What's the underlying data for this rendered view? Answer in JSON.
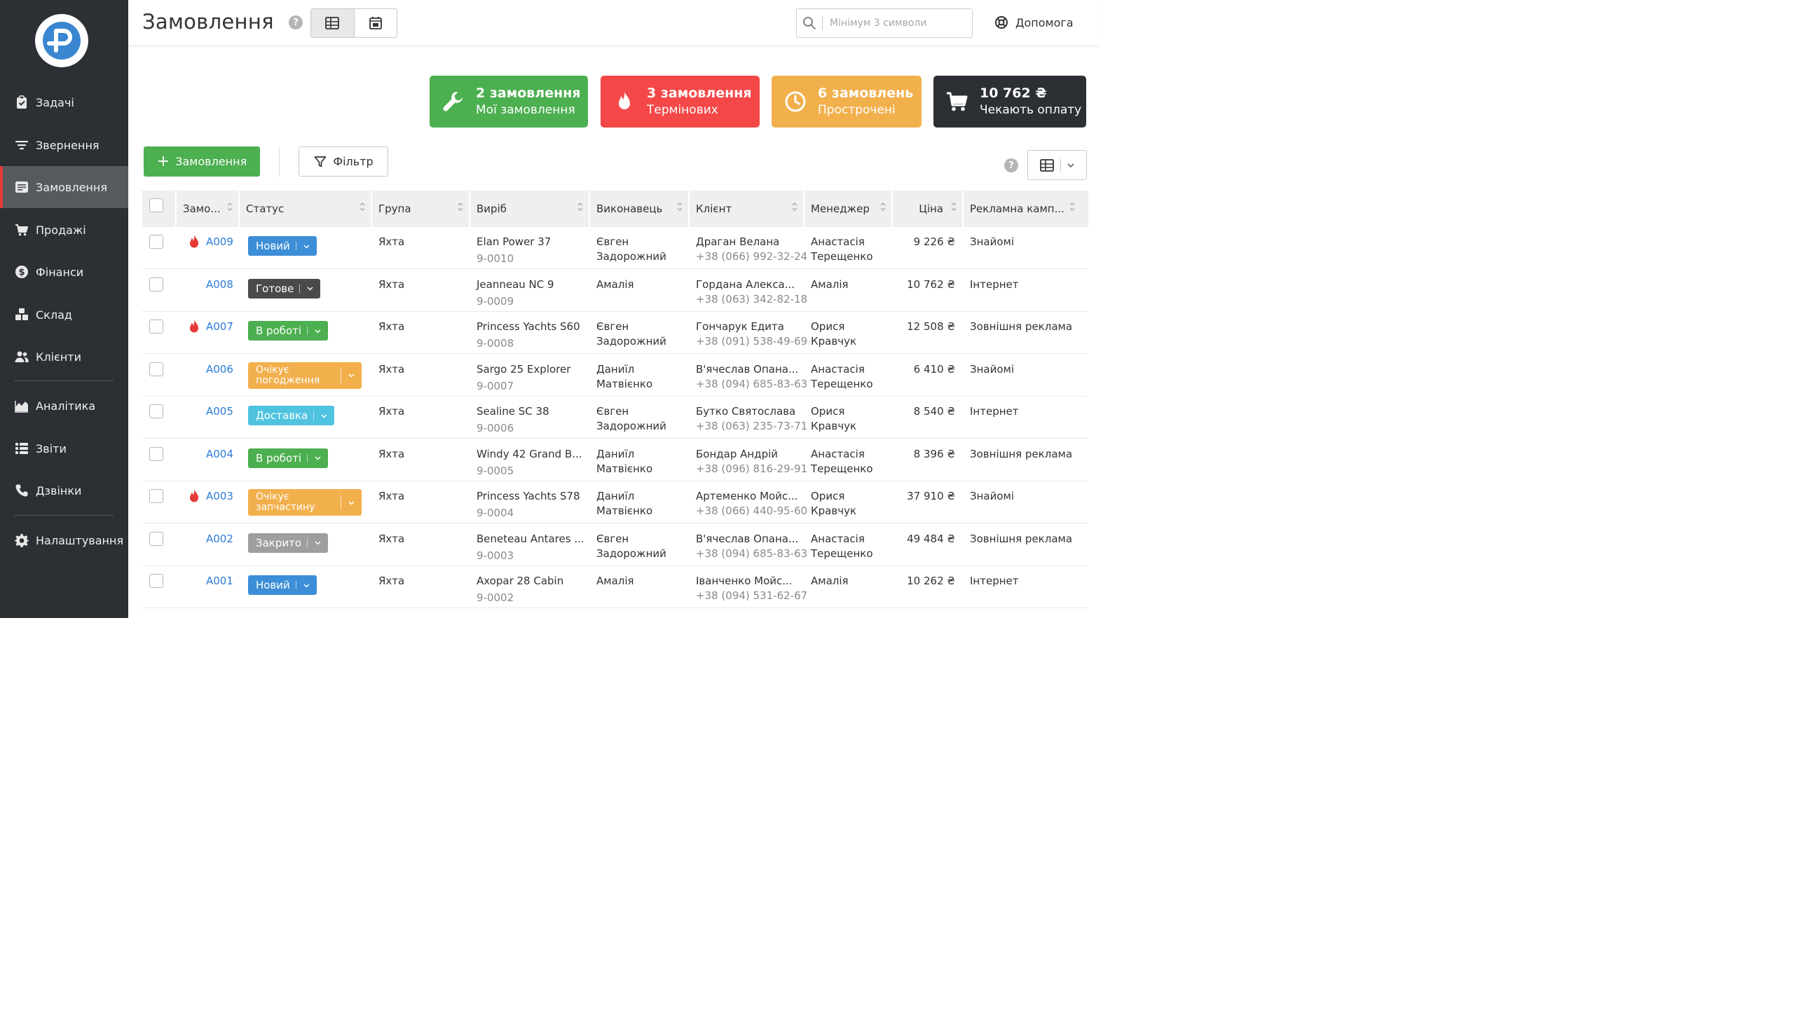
{
  "app": {
    "page_title": "Замовлення",
    "search_placeholder": "Мінімум 3 символи",
    "help_label": "Допомога",
    "help_mark": "?"
  },
  "nav": {
    "items": [
      {
        "label": "Задачі",
        "icon": "clipboard-check-icon"
      },
      {
        "label": "Звернення",
        "icon": "filter-lines-icon"
      },
      {
        "label": "Замовлення",
        "icon": "order-list-icon",
        "active": true
      },
      {
        "label": "Продажі",
        "icon": "cart-icon"
      },
      {
        "label": "Фінанси",
        "icon": "dollar-coin-icon"
      },
      {
        "label": "Склад",
        "icon": "boxes-icon"
      },
      {
        "label": "Клієнти",
        "icon": "users-icon"
      },
      {
        "label": "Аналітика",
        "icon": "area-chart-icon"
      },
      {
        "label": "Звіти",
        "icon": "report-list-icon"
      },
      {
        "label": "Дзвінки",
        "icon": "phone-icon"
      },
      {
        "label": "Налаштування",
        "icon": "gear-icon"
      }
    ]
  },
  "cards": [
    {
      "title": "2 замовлення",
      "subtitle": "Мої замовлення",
      "color": "#4caf50",
      "icon": "wrench-icon"
    },
    {
      "title": "3 замовлення",
      "subtitle": "Термінових",
      "color": "#f44848",
      "icon": "fire-icon"
    },
    {
      "title": "6 замовлень",
      "subtitle": "Прострочені",
      "color": "#f2b04d",
      "icon": "clock-icon"
    },
    {
      "title": "10 762 ₴",
      "subtitle": "Чекають оплату",
      "color": "#2c3034",
      "icon": "cart-icon"
    }
  ],
  "toolbar": {
    "add_plus": "+",
    "add_label": "Замовлення",
    "filter_label": "Фільтр"
  },
  "columns": [
    "Замо...",
    "Статус",
    "Група",
    "Виріб",
    "Виконавець",
    "Клієнт",
    "Менеджер",
    "Ціна",
    "Рекламна камп..."
  ],
  "status_colors": {
    "Новий": "#3c8ed6",
    "Готове": "#4a4a4a",
    "В роботі": "#4caf50",
    "Очікує погодження": "#f2b04d",
    "Доставка": "#4fc3e0",
    "Очікує запчастину": "#f2b04d",
    "Закрито": "#9e9e9e"
  },
  "orders": [
    {
      "id": "A009",
      "urgent": true,
      "status": "Новий",
      "status_lines": [
        "Новий"
      ],
      "group": "Яхта",
      "product": "Elan Power 37",
      "product_code": "9-0010",
      "executor": [
        "Євген",
        "Задорожний"
      ],
      "client": "Драган Велана",
      "phone": "+38 (066) 992-32-24",
      "manager": [
        "Анастасія",
        "Терещенко"
      ],
      "price": "9 226 ₴",
      "campaign": "Знайомі"
    },
    {
      "id": "A008",
      "urgent": false,
      "status": "Готове",
      "status_lines": [
        "Готове"
      ],
      "group": "Яхта",
      "product": "Jeanneau NC 9",
      "product_code": "9-0009",
      "executor": [
        "Амалія",
        ""
      ],
      "client": "Гордана Алекса...",
      "phone": "+38 (063) 342-82-18",
      "manager": [
        "Амалія",
        ""
      ],
      "price": "10 762 ₴",
      "campaign": "Інтернет"
    },
    {
      "id": "A007",
      "urgent": true,
      "status": "В роботі",
      "status_lines": [
        "В роботі"
      ],
      "group": "Яхта",
      "product": "Princess Yachts S60",
      "product_code": "9-0008",
      "executor": [
        "Євген",
        "Задорожний"
      ],
      "client": "Гончарук Едита",
      "phone": "+38 (091) 538-49-69",
      "manager": [
        "Орися",
        "Кравчук"
      ],
      "price": "12 508 ₴",
      "campaign": "Зовнішня реклама"
    },
    {
      "id": "A006",
      "urgent": false,
      "status": "Очікує погодження",
      "status_lines": [
        "Очікує",
        "погодження"
      ],
      "group": "Яхта",
      "product": "Sargo 25 Explorer",
      "product_code": "9-0007",
      "executor": [
        "Даниїл",
        "Матвієнко"
      ],
      "client": "В'ячеслав Опана...",
      "phone": "+38 (094) 685-83-63",
      "manager": [
        "Анастасія",
        "Терещенко"
      ],
      "price": "6 410 ₴",
      "campaign": "Знайомі"
    },
    {
      "id": "A005",
      "urgent": false,
      "status": "Доставка",
      "status_lines": [
        "Доставка"
      ],
      "group": "Яхта",
      "product": "Sealine SC 38",
      "product_code": "9-0006",
      "executor": [
        "Євген",
        "Задорожний"
      ],
      "client": "Бутко Святослава",
      "phone": "+38 (063) 235-73-71",
      "manager": [
        "Орися",
        "Кравчук"
      ],
      "price": "8 540 ₴",
      "campaign": "Інтернет"
    },
    {
      "id": "A004",
      "urgent": false,
      "status": "В роботі",
      "status_lines": [
        "В роботі"
      ],
      "group": "Яхта",
      "product": "Windy 42 Grand B...",
      "product_code": "9-0005",
      "executor": [
        "Даниїл",
        "Матвієнко"
      ],
      "client": "Бондар Андрій",
      "phone": "+38 (096) 816-29-91",
      "manager": [
        "Анастасія",
        "Терещенко"
      ],
      "price": "8 396 ₴",
      "campaign": "Зовнішня реклама"
    },
    {
      "id": "A003",
      "urgent": true,
      "status": "Очікує запчастину",
      "status_lines": [
        "Очікує",
        "запчастину"
      ],
      "group": "Яхта",
      "product": "Princess Yachts S78",
      "product_code": "9-0004",
      "executor": [
        "Даниїл",
        "Матвієнко"
      ],
      "client": "Артеменко Мойс...",
      "phone": "+38 (066) 440-95-60",
      "manager": [
        "Орися",
        "Кравчук"
      ],
      "price": "37 910 ₴",
      "campaign": "Знайомі"
    },
    {
      "id": "A002",
      "urgent": false,
      "status": "Закрито",
      "status_lines": [
        "Закрито"
      ],
      "group": "Яхта",
      "product": "Beneteau Antares ...",
      "product_code": "9-0003",
      "executor": [
        "Євген",
        "Задорожний"
      ],
      "client": "В'ячеслав Опана...",
      "phone": "+38 (094) 685-83-63",
      "manager": [
        "Анастасія",
        "Терещенко"
      ],
      "price": "49 484 ₴",
      "campaign": "Зовнішня реклама"
    },
    {
      "id": "A001",
      "urgent": false,
      "status": "Новий",
      "status_lines": [
        "Новий"
      ],
      "group": "Яхта",
      "product": "Axopar 28 Cabin",
      "product_code": "9-0002",
      "executor": [
        "Амалія",
        ""
      ],
      "client": "Іванченко Мойс...",
      "phone": "+38 (094) 531-62-67",
      "manager": [
        "Амалія",
        ""
      ],
      "price": "10 262 ₴",
      "campaign": "Інтернет"
    }
  ]
}
